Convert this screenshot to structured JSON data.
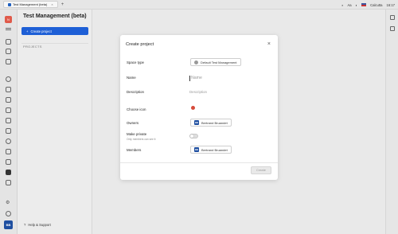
{
  "browser": {
    "tab_label": "Test Management (beta)",
    "tab_close": "×",
    "new_tab": "+",
    "language": "Aa",
    "location": "Calcutta",
    "time": "16:17"
  },
  "rail": {
    "avatar_letter": "N",
    "user_initials": "BB"
  },
  "sidebar": {
    "title": "Test Management (beta)",
    "create_label": "Create project",
    "create_icon": "+",
    "projects_heading": "PROJECTS",
    "help_label": "Help & Support"
  },
  "modal": {
    "title": "Create project",
    "close": "×",
    "space_type_label": "Space type",
    "space_type_value": "Default Test Management",
    "name_label": "Name",
    "name_placeholder": "Name",
    "description_label": "Description",
    "description_placeholder": "Description",
    "choose_icon_label": "Choose icon",
    "owners_label": "Owners",
    "owner_initials": "BB",
    "owner_name": "Bertrand Bruandet",
    "make_private_label": "Make private",
    "make_private_hint": "Only members can see it",
    "make_private_on": false,
    "members_label": "Members",
    "member_initials": "BB",
    "member_name": "Bertrand Bruandet",
    "create_button": "Create"
  },
  "colors": {
    "primary": "#1e5fd6",
    "avatar": "#e05a4a",
    "user_badge": "#1f4fa0",
    "icon_pick": "#d64b3b"
  }
}
